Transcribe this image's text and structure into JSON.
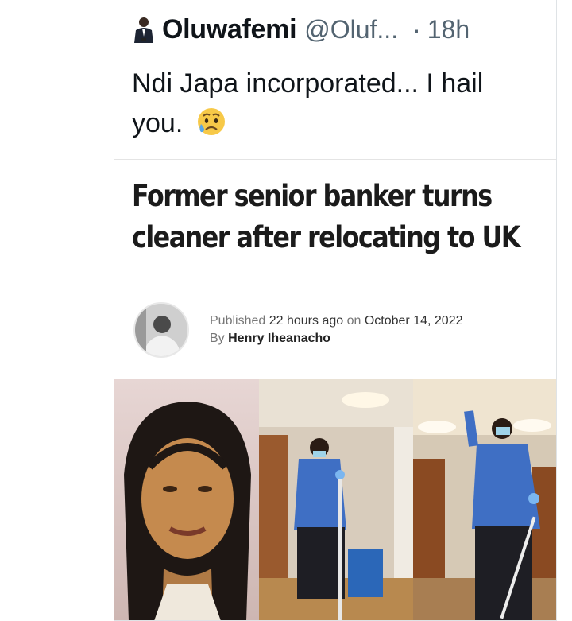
{
  "tweet": {
    "author_name": "Oluwafemi",
    "handle": "@Oluf...",
    "separator": "·",
    "time": "18h",
    "text": "Ndi Japa incorporated... I hail you.",
    "emoji": "sad-but-relieved-face"
  },
  "article": {
    "headline": "Former senior banker turns cleaner after relocating to UK",
    "published_label": "Published",
    "published_ago": "22 hours ago",
    "on_label": "on",
    "published_date": "October 14, 2022",
    "by_label": "By",
    "author": "Henry Iheanacho"
  },
  "colors": {
    "text": "#0f1419",
    "muted": "#536471",
    "headline": "#1b1b1b",
    "scrubs_blue": "#3f6fc4"
  }
}
